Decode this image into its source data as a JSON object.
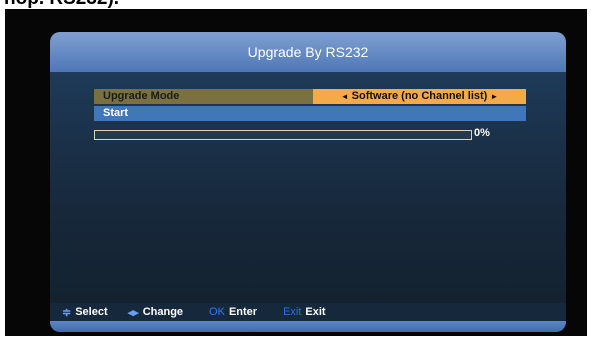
{
  "page": {
    "clipped_heading": "nop. RS232)."
  },
  "osd": {
    "title": "Upgrade By RS232",
    "upgrade_mode": {
      "label": "Upgrade Mode",
      "value": "Software (no Channel list)",
      "left_arrow": "◄",
      "right_arrow": "►"
    },
    "start_label": "Start",
    "progress": {
      "percent_text": "0%",
      "fraction": 0.0
    },
    "footer": {
      "select": {
        "key": "≑",
        "label": "Select"
      },
      "change": {
        "key": "◂▸",
        "label": "Change"
      },
      "ok": {
        "key": "OK",
        "label": "Enter"
      },
      "exit": {
        "key": "Exit",
        "label": "Exit"
      }
    }
  },
  "colors": {
    "header": "#4f78b6",
    "mode_label_bg": "#7a7041",
    "mode_value_bg": "#f3aa49",
    "start_bg": "#3f77b8",
    "progress_fill": "#f3f3a7"
  }
}
